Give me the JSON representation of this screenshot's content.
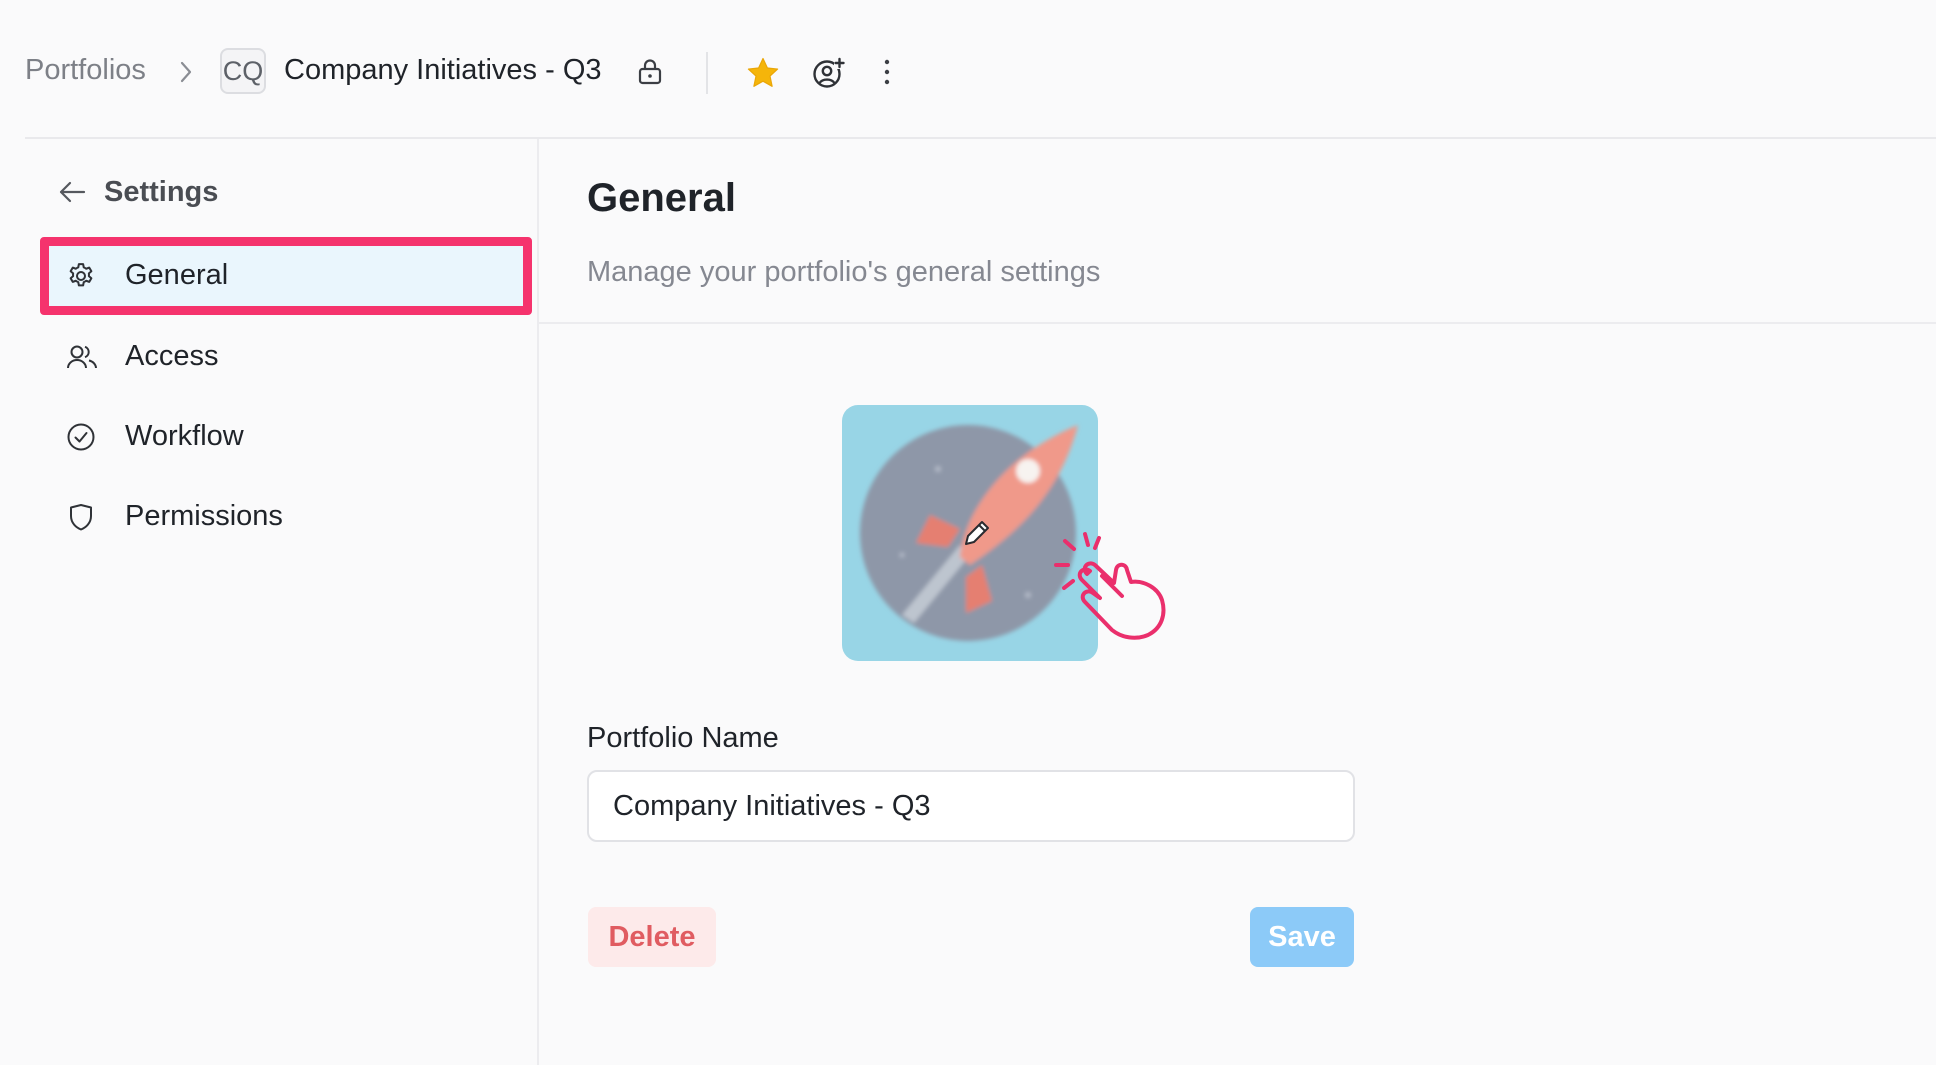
{
  "header": {
    "breadcrumb_root": "Portfolios",
    "avatar_initials": "CQ",
    "portfolio_title": "Company Initiatives - Q3",
    "icons": {
      "chevron": "chevron-right-icon",
      "lock": "lock-icon",
      "favorite": "star-icon",
      "follow": "user-add-icon",
      "more": "more-vertical-icon"
    },
    "favorite_color": "#f5b50a"
  },
  "sidebar": {
    "title": "Settings",
    "back_icon": "arrow-left-icon",
    "items": [
      {
        "label": "General",
        "icon": "gear-icon",
        "active": true
      },
      {
        "label": "Access",
        "icon": "users-icon",
        "active": false
      },
      {
        "label": "Workflow",
        "icon": "check-circle-icon",
        "active": false
      },
      {
        "label": "Permissions",
        "icon": "shield-icon",
        "active": false
      }
    ],
    "highlight_color": "#f5336d"
  },
  "main": {
    "title": "General",
    "subtitle": "Manage your portfolio's general settings",
    "image": {
      "description_icon": "rocket-icon",
      "edit_icon": "pencil-icon",
      "pointer_icon": "click-hand-icon"
    },
    "portfolio_name_label": "Portfolio Name",
    "portfolio_name_value": "Company Initiatives - Q3",
    "delete_label": "Delete",
    "save_label": "Save"
  },
  "colors": {
    "accent": "#8ccaf8",
    "danger": "#e05c61",
    "active_nav_bg": "#eaf6fd"
  }
}
